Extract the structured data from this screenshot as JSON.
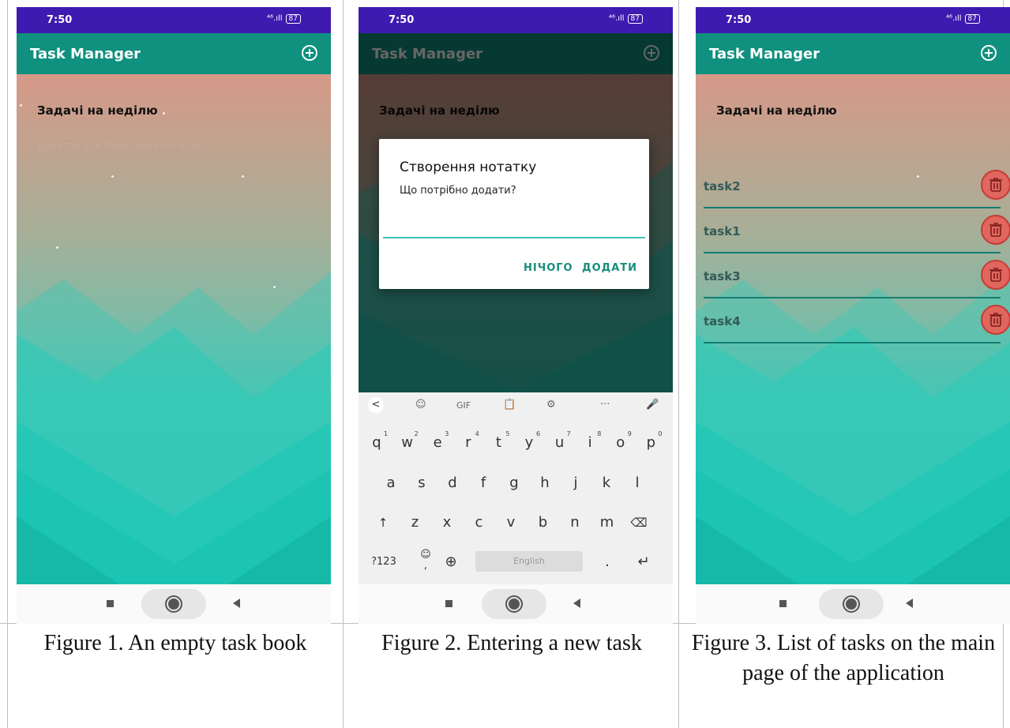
{
  "status": {
    "time": "7:50",
    "signal": "⁴⁶.ıll",
    "battery": "87"
  },
  "app": {
    "title": "Task Manager",
    "heading": "Задачі на неділю",
    "subtitle": "Додаток для зберігання нотаток"
  },
  "dialog": {
    "title": "Створення нотатку",
    "message": "Що потрібно додати?",
    "cancel_label": "НІЧОГО",
    "confirm_label": "ДОДАТИ"
  },
  "keyboard": {
    "toolbar": [
      "<",
      "☺",
      "GIF",
      "📋",
      "⚙",
      "···",
      "🎤"
    ],
    "row1": [
      {
        "k": "q",
        "n": "1"
      },
      {
        "k": "w",
        "n": "2"
      },
      {
        "k": "e",
        "n": "3"
      },
      {
        "k": "r",
        "n": "4"
      },
      {
        "k": "t",
        "n": "5"
      },
      {
        "k": "y",
        "n": "6"
      },
      {
        "k": "u",
        "n": "7"
      },
      {
        "k": "i",
        "n": "8"
      },
      {
        "k": "o",
        "n": "9"
      },
      {
        "k": "p",
        "n": "0"
      }
    ],
    "row2": [
      "a",
      "s",
      "d",
      "f",
      "g",
      "h",
      "j",
      "k",
      "l"
    ],
    "row3": [
      "↑",
      "z",
      "x",
      "c",
      "v",
      "b",
      "n",
      "m",
      "⌫"
    ],
    "row4": {
      "sym": "?123",
      "emoji": "☺",
      "comma": ",",
      "globe": "⊕",
      "space": "English",
      "period": ".",
      "enter": "↵"
    }
  },
  "tasks": [
    "task2",
    "task1",
    "task3",
    "task4"
  ],
  "captions": [
    "Figure 1. An empty task book",
    "Figure 2. Entering a new task",
    "Figure 3. List of tasks on the main page of the application"
  ],
  "colors": {
    "status_bar": "#3f1ab0",
    "app_bar": "#10907e",
    "accent": "#178c7d",
    "delete_button": "#e0665e"
  }
}
